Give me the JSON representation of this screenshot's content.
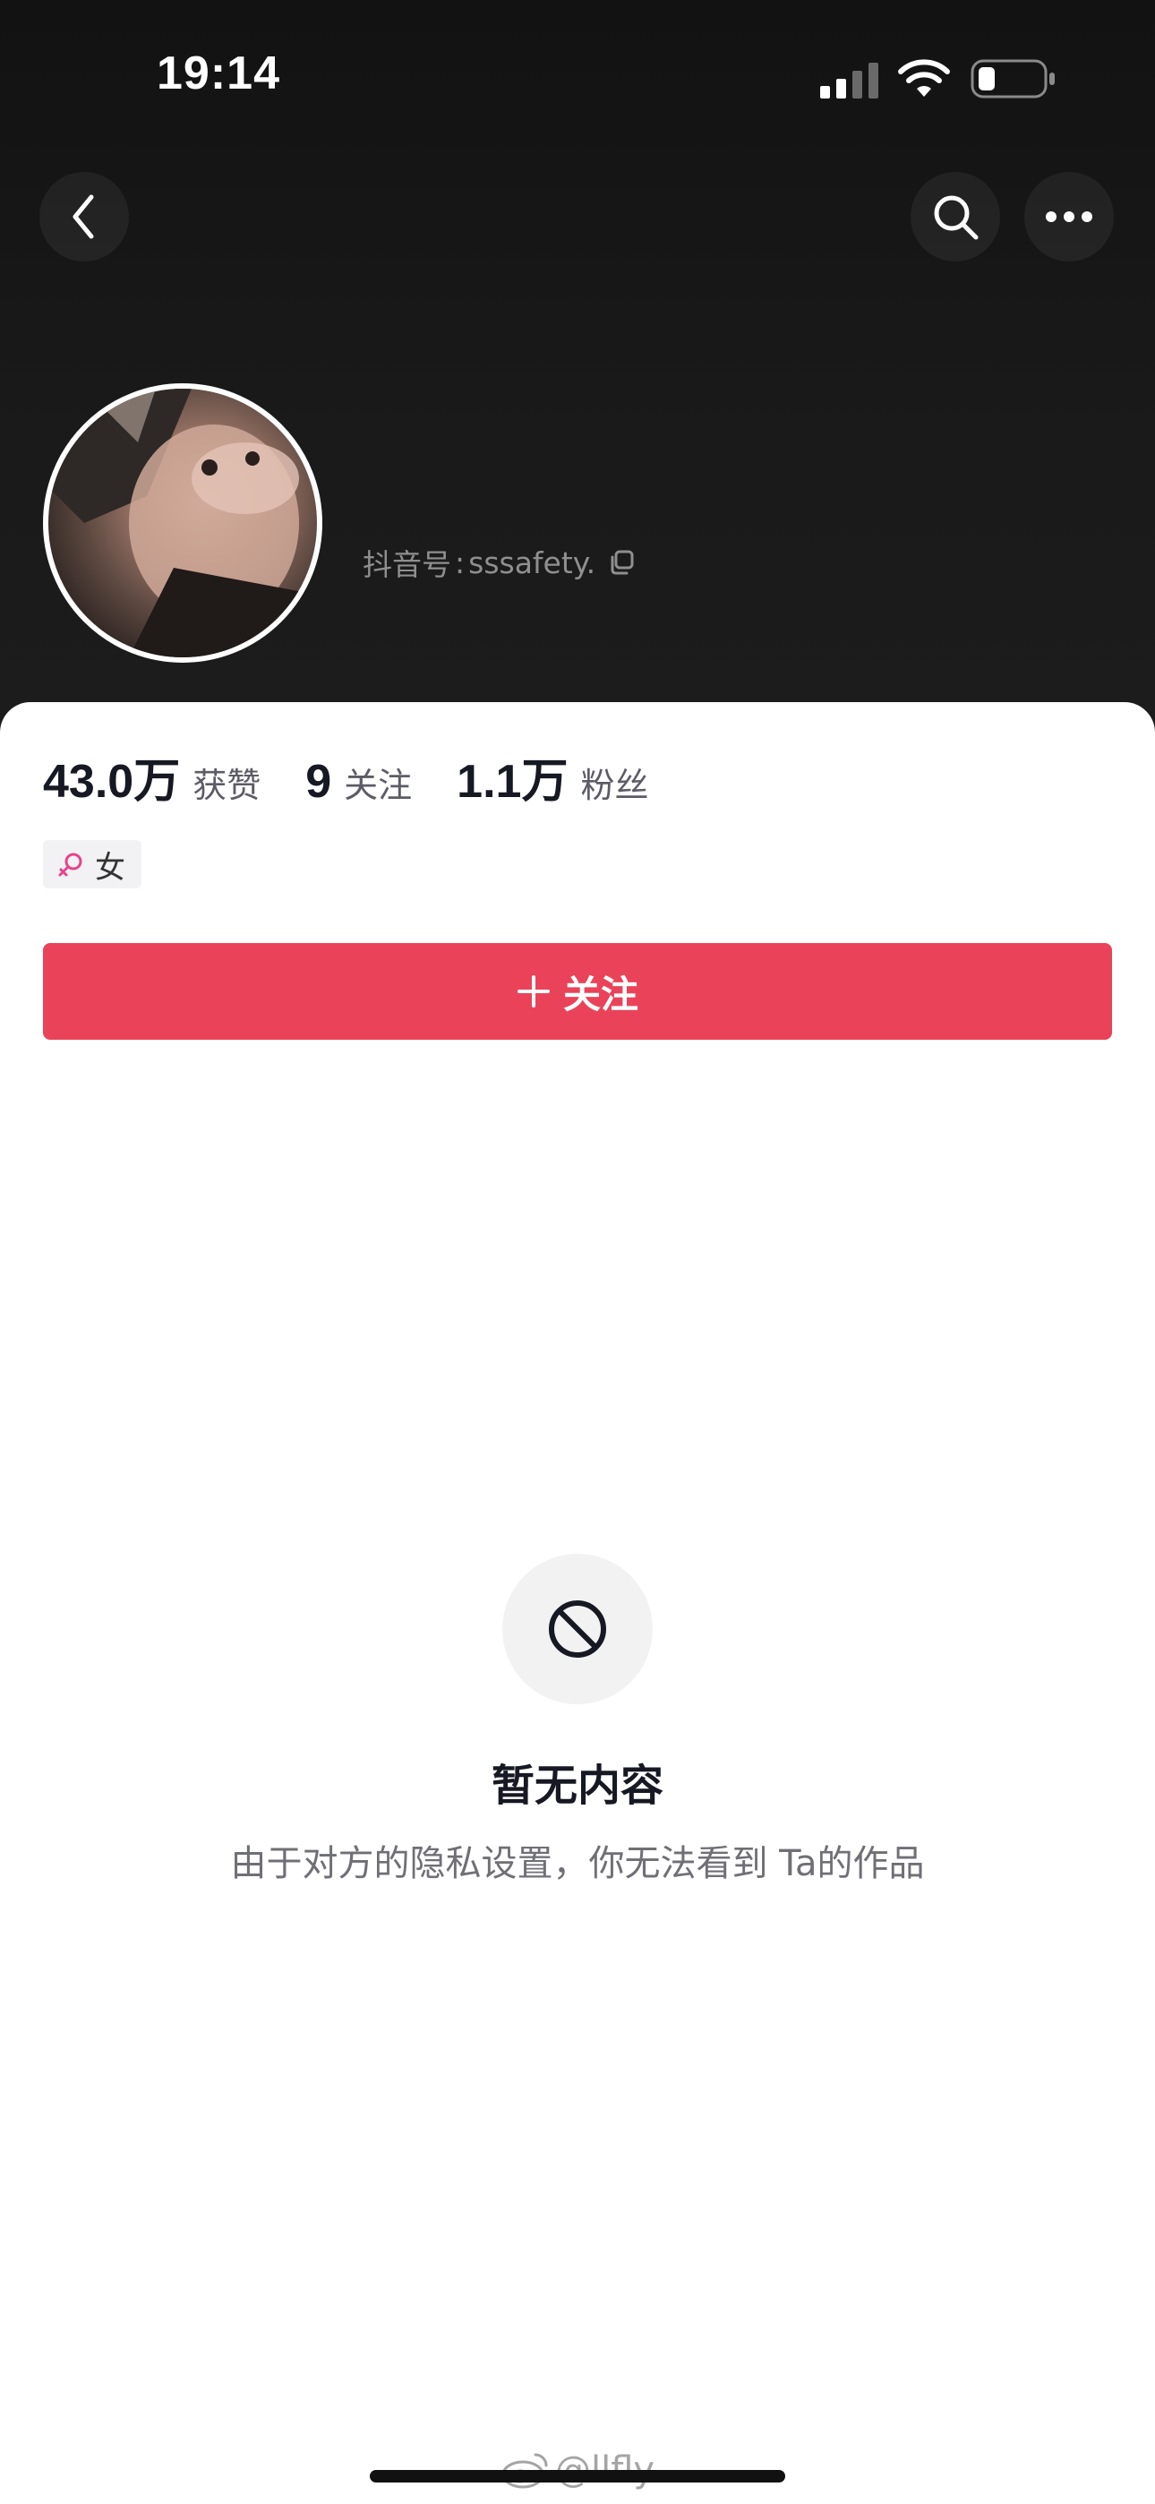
{
  "status_bar": {
    "time": "19:14",
    "icons": [
      "cellular-signal-icon",
      "wifi-icon",
      "battery-icon"
    ]
  },
  "nav": {
    "back_icon": "chevron-left-icon",
    "search_icon": "search-icon",
    "more_icon": "more-horizontal-icon"
  },
  "profile": {
    "handle_label": "抖音号",
    "handle_separator": ":",
    "handle_value": "sssafety.",
    "copy_icon": "copy-icon"
  },
  "stats": [
    {
      "value": "43.0万",
      "label": "获赞"
    },
    {
      "value": "9",
      "label": "关注"
    },
    {
      "value": "1.1万",
      "label": "粉丝"
    }
  ],
  "gender_tag": {
    "label": "女",
    "icon": "female-symbol-icon",
    "color": "#e8438c"
  },
  "follow_button": {
    "label": "关注",
    "icon": "plus-icon",
    "color": "#ea4359"
  },
  "empty_state": {
    "icon": "prohibited-icon",
    "title": "暂无内容",
    "subtitle": "由于对方的隐私设置，你无法看到 Ta的作品"
  },
  "watermark": {
    "text": "@llfly",
    "icon": "weibo-logo-icon"
  }
}
